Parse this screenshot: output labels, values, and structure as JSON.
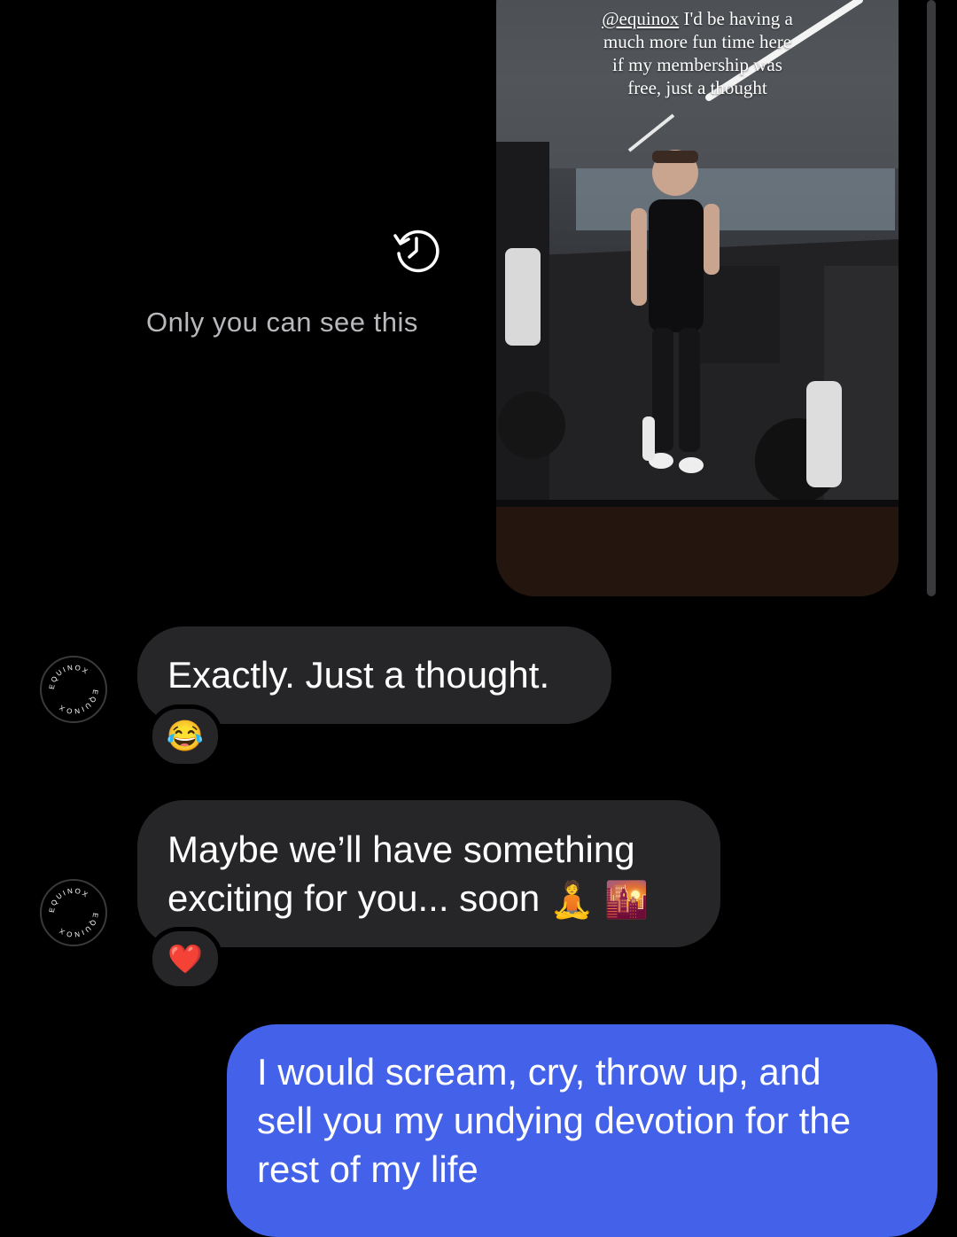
{
  "story_reply": {
    "caption_mention": "@equinox",
    "caption_lines": [
      " I'd be having a",
      "much more fun time here",
      "if my membership was",
      "free, just a thought"
    ]
  },
  "notice": {
    "text": "Only you can see this",
    "icon": "history-icon"
  },
  "sender": {
    "avatar_text": "EQUINOX"
  },
  "messages": [
    {
      "direction": "incoming",
      "text": "Exactly. Just a thought.",
      "reaction": "😂"
    },
    {
      "direction": "incoming",
      "line1": "Maybe we’ll have something",
      "line2": "exciting for you... soon",
      "emojis": [
        "🧘",
        "🌇"
      ],
      "reaction": "❤️"
    },
    {
      "direction": "outgoing",
      "line1": "I would scream, cry, throw up, and",
      "line2": "sell you my undying devotion for the",
      "line3": "rest of my life"
    }
  ],
  "colors": {
    "background": "#000000",
    "incoming_bubble": "#262628",
    "outgoing_bubble": "#4361e9",
    "muted_text": "#b8b8bd"
  }
}
